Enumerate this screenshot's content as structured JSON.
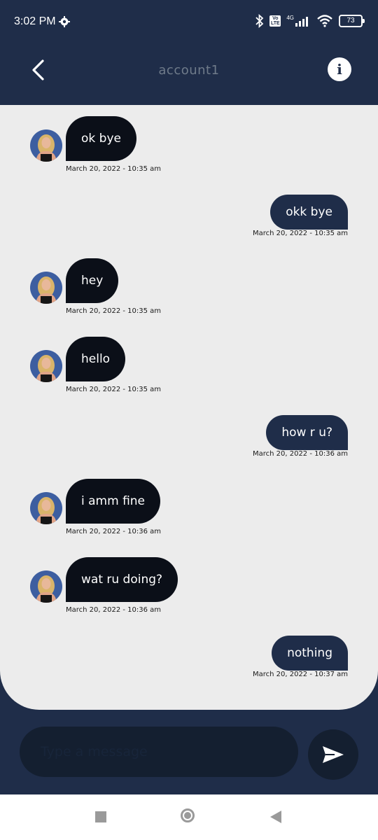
{
  "status": {
    "time": "3:02 PM",
    "network_badge": "Vo LTE",
    "network_type": "4G",
    "battery": "73"
  },
  "header": {
    "title": "account1",
    "back_icon": "chevron-left-icon",
    "info_icon": "info-icon"
  },
  "messages": [
    {
      "side": "in",
      "text": "ok bye",
      "time": "March 20, 2022 - 10:35 am"
    },
    {
      "side": "out",
      "text": "okk bye",
      "time": "March 20, 2022 - 10:35 am"
    },
    {
      "side": "in",
      "text": "hey",
      "time": "March 20, 2022 - 10:35 am"
    },
    {
      "side": "in",
      "text": "hello",
      "time": "March 20, 2022 - 10:35 am"
    },
    {
      "side": "out",
      "text": "how r u?",
      "time": "March 20, 2022 - 10:36 am"
    },
    {
      "side": "in",
      "text": "i amm fine",
      "time": "March 20, 2022 - 10:36 am"
    },
    {
      "side": "in",
      "text": "wat ru doing?",
      "time": "March 20, 2022 - 10:36 am"
    },
    {
      "side": "out",
      "text": "nothing",
      "time": "March 20, 2022 - 10:37 am"
    }
  ],
  "composer": {
    "placeholder": "Type a message",
    "send_icon": "send-icon"
  },
  "colors": {
    "primary": "#1f2d49",
    "incoming_bubble": "#0b0f18",
    "chat_background": "#ececec"
  }
}
